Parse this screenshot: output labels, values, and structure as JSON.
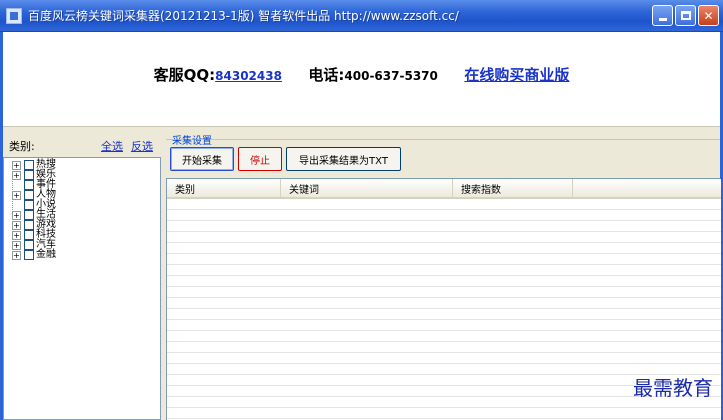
{
  "window": {
    "title": "百度风云榜关键词采集器(20121213-1版) 智者软件出品 http://www.zzsoft.cc/",
    "controls": [
      "minimize-icon",
      "maximize-icon",
      "close-icon"
    ]
  },
  "banner": {
    "qq_label": "客服QQ:",
    "qq_number": "84302438",
    "phone_label": "电话:",
    "phone_number": "400-637-5370",
    "buy_link": "在线购买商业版"
  },
  "sidebar": {
    "category_label": "类别:",
    "select_all": "全选",
    "invert_select": "反选",
    "items": [
      {
        "label": "热搜",
        "expandable": true
      },
      {
        "label": "娱乐",
        "expandable": true
      },
      {
        "label": "事件",
        "expandable": false
      },
      {
        "label": "人物",
        "expandable": true
      },
      {
        "label": "小说",
        "expandable": false
      },
      {
        "label": "生活",
        "expandable": true
      },
      {
        "label": "游戏",
        "expandable": true
      },
      {
        "label": "科技",
        "expandable": true
      },
      {
        "label": "汽车",
        "expandable": true
      },
      {
        "label": "金融",
        "expandable": true
      }
    ]
  },
  "settings": {
    "group_title": "采集设置",
    "start_button": "开始采集",
    "stop_button": "停止",
    "export_button": "导出采集结果为TXT"
  },
  "results_table": {
    "columns": [
      "类别",
      "关键词",
      "搜索指数"
    ],
    "rows": []
  },
  "watermark": "最需教育",
  "colors": {
    "titlebar": "#2c63d6",
    "link": "#1a33c8",
    "stop": "#d00000"
  }
}
